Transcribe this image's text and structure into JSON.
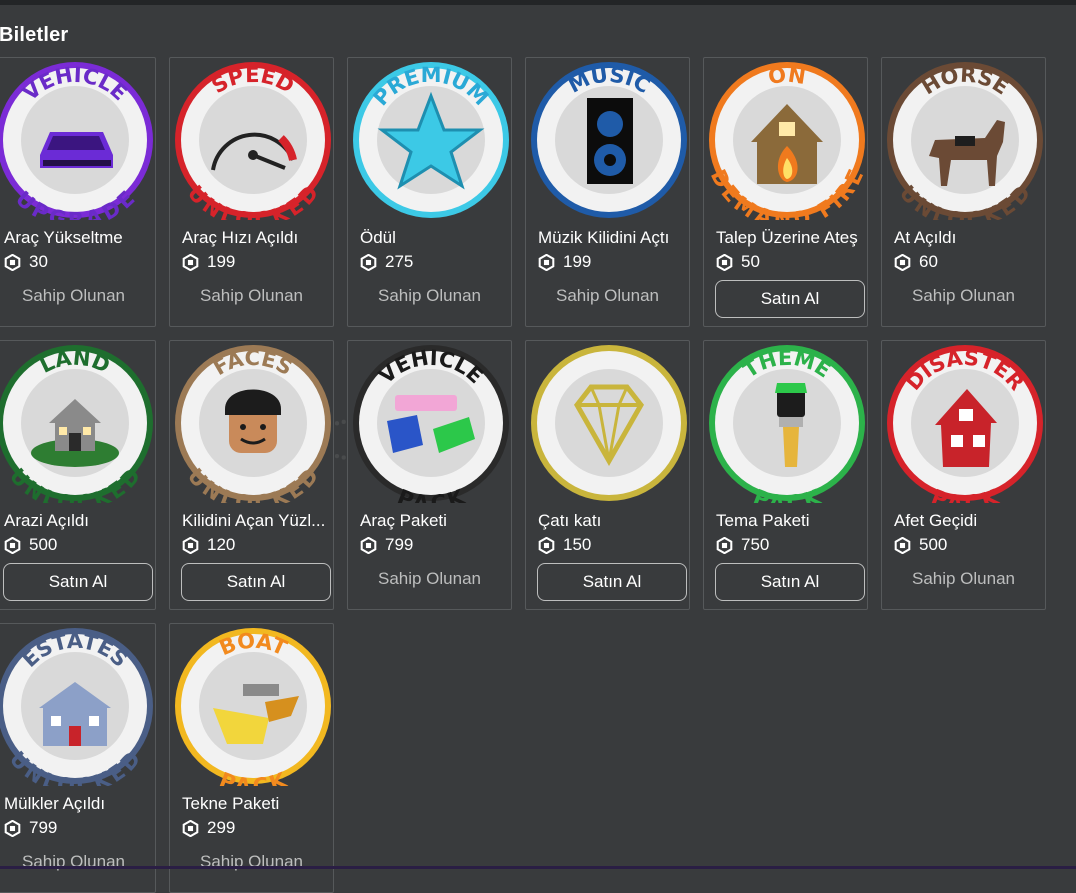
{
  "section": {
    "title": "Biletler"
  },
  "colors": {
    "background": "#393B3D",
    "card_border": "#56595B",
    "muted_text": "#BDBEBE"
  },
  "items": [
    {
      "name": "Araç Yükseltme",
      "price": "30",
      "status": "Sahip Olunan",
      "action": "",
      "badge": {
        "top": "VEHICLE",
        "bottom": "UPGRADE",
        "ring": "#7B2BD6",
        "text": "#6A2BC8",
        "icon": "purple-car-icon"
      }
    },
    {
      "name": "Araç Hızı Açıldı",
      "price": "199",
      "status": "Sahip Olunan",
      "action": "",
      "badge": {
        "top": "SPEED",
        "bottom": "UNLOCKED",
        "ring": "#D6232A",
        "text": "#D6232A",
        "icon": "speedometer-icon"
      }
    },
    {
      "name": "Ödül",
      "price": "275",
      "status": "Sahip Olunan",
      "action": "",
      "badge": {
        "top": "PREMIUM",
        "bottom": "",
        "ring": "#3CC9E6",
        "text": "#2AA9D6",
        "icon": "star-icon"
      }
    },
    {
      "name": "Müzik Kilidini Açtı",
      "price": "199",
      "status": "Sahip Olunan",
      "action": "",
      "badge": {
        "top": "MUSIC",
        "bottom": "",
        "ring": "#1F5BA8",
        "text": "#1F5BA8",
        "icon": "speaker-icon"
      }
    },
    {
      "name": "Talep Üzerine Ateş",
      "price": "50",
      "status": "",
      "action": "Satın Al",
      "badge": {
        "top": "ON",
        "bottom": "DEMAND FIRE",
        "ring": "#F07A1E",
        "text": "#F07A1E",
        "icon": "burning-house-icon"
      }
    },
    {
      "name": "At Açıldı",
      "price": "60",
      "status": "Sahip Olunan",
      "action": "",
      "badge": {
        "top": "HORSE",
        "bottom": "UNLOCKED",
        "ring": "#6B4A35",
        "text": "#6B4A35",
        "icon": "horse-icon"
      }
    },
    {
      "name": "Arazi Açıldı",
      "price": "500",
      "status": "",
      "action": "Satın Al",
      "badge": {
        "top": "LAND",
        "bottom": "UNLOCKED",
        "ring": "#1E6E2E",
        "text": "#1E6E2E",
        "icon": "house-on-land-icon"
      }
    },
    {
      "name": "Kilidini Açan Yüzl...",
      "price": "120",
      "status": "",
      "action": "Satın Al",
      "badge": {
        "top": "FACES",
        "bottom": "UNLOCKED",
        "ring": "#9C7A55",
        "text": "#9C7A55",
        "icon": "avatar-face-icon"
      }
    },
    {
      "name": "Araç Paketi",
      "price": "799",
      "status": "Sahip Olunan",
      "action": "",
      "badge": {
        "top": "VEHICLE",
        "bottom": "PACK",
        "ring": "#2A2A2A",
        "text": "#1A1A1A",
        "icon": "cars-pack-icon"
      }
    },
    {
      "name": "Çatı katı",
      "price": "150",
      "status": "",
      "action": "Satın Al",
      "badge": {
        "top": "",
        "bottom": "",
        "ring": "#C9B53C",
        "text": "#C9B53C",
        "icon": "diamond-icon"
      }
    },
    {
      "name": "Tema Paketi",
      "price": "750",
      "status": "",
      "action": "Satın Al",
      "badge": {
        "top": "THEME",
        "bottom": "PACK",
        "ring": "#2CB24A",
        "text": "#2CB24A",
        "icon": "paintbrush-icon"
      }
    },
    {
      "name": "Afet Geçidi",
      "price": "500",
      "status": "Sahip Olunan",
      "action": "",
      "badge": {
        "top": "DISASTER",
        "bottom": "PACK",
        "ring": "#D6232A",
        "text": "#D6232A",
        "icon": "disaster-house-icon"
      }
    },
    {
      "name": "Mülkler Açıldı",
      "price": "799",
      "status": "Sahip Olunan",
      "action": "",
      "badge": {
        "top": "ESTATES",
        "bottom": "UNLOCKED",
        "ring": "#4A5E86",
        "text": "#4A5E86",
        "icon": "estate-building-icon"
      }
    },
    {
      "name": "Tekne Paketi",
      "price": "299",
      "status": "Sahip Olunan",
      "action": "",
      "badge": {
        "top": "BOAT",
        "bottom": "PACK",
        "ring": "#F2B820",
        "text": "#F28A1E",
        "icon": "boats-icon"
      }
    }
  ]
}
